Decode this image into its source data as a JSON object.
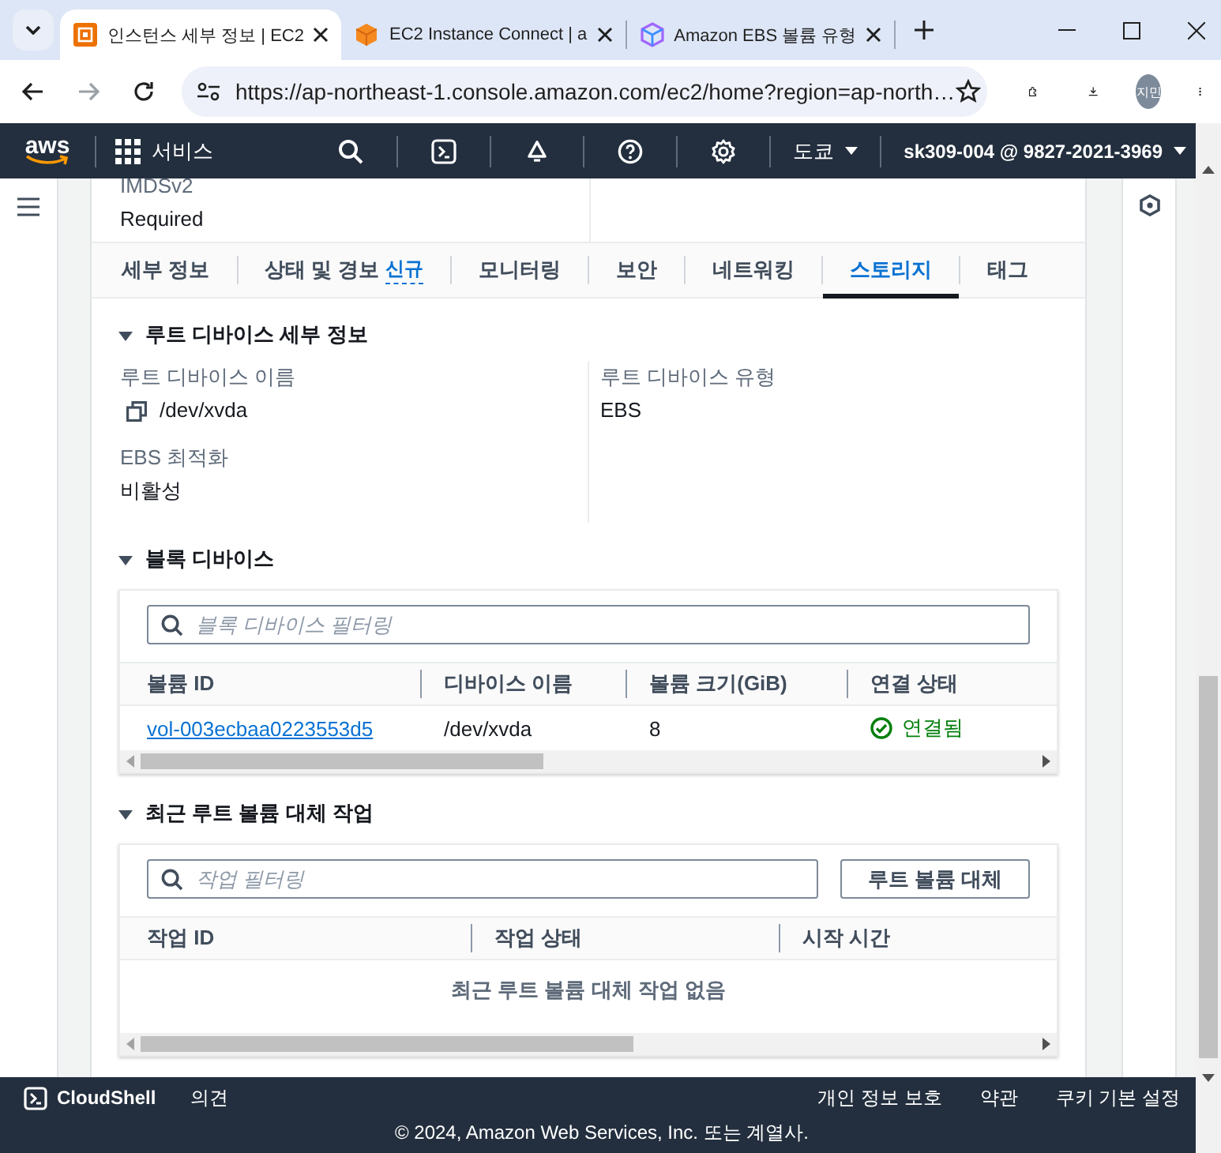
{
  "browser": {
    "tabs": [
      {
        "title": "인스턴스 세부 정보 | EC2",
        "selected": true
      },
      {
        "title": "EC2 Instance Connect | a",
        "selected": false
      },
      {
        "title": "Amazon EBS 볼륨 유형",
        "selected": false
      }
    ],
    "url": "https://ap-northeast-1.console.amazon.com/ec2/home?region=ap-north…",
    "profile": "지민"
  },
  "console_nav": {
    "logo": "aws",
    "services": "서비스",
    "region": "도쿄",
    "account": "sk309-004 @ 9827-2021-3969"
  },
  "summary": {
    "label": "IMDSv2",
    "value": "Required"
  },
  "tabs": [
    {
      "label": "세부 정보",
      "selected": false
    },
    {
      "label": "상태 및 경보",
      "badge": "신규",
      "selected": false
    },
    {
      "label": "모니터링",
      "selected": false
    },
    {
      "label": "보안",
      "selected": false
    },
    {
      "label": "네트워킹",
      "selected": false
    },
    {
      "label": "스토리지",
      "selected": true
    },
    {
      "label": "태그",
      "selected": false
    }
  ],
  "root_device": {
    "title": "루트 디바이스 세부 정보",
    "expanded": true,
    "fields": [
      {
        "label": "루트 디바이스 이름",
        "value": "/dev/xvda",
        "copyable": true
      },
      {
        "label": "루트 디바이스 유형",
        "value": "EBS",
        "copyable": false
      },
      {
        "label": "EBS 최적화",
        "value": "비활성",
        "copyable": false
      }
    ]
  },
  "block_devices": {
    "title": "블록 디바이스",
    "expanded": true,
    "filter": {
      "placeholder": "블록 디바이스 필터링"
    },
    "columns": [
      "볼륨 ID",
      "디바이스 이름",
      "볼륨 크기(GiB)",
      "연결 상태"
    ],
    "rows": [
      {
        "cells": [
          {
            "kind": "link",
            "text": "vol-003ecbaa0223553d5"
          },
          {
            "kind": "text",
            "text": "/dev/xvda"
          },
          {
            "kind": "text",
            "text": "8"
          },
          {
            "kind": "status",
            "text": "연결됨"
          }
        ]
      }
    ]
  },
  "root_volume_replacement": {
    "title": "최근 루트 볼륨 대체 작업",
    "expanded": true,
    "filter": {
      "placeholder": "작업 필터링"
    },
    "button": "루트 볼륨 대체",
    "columns": [
      "작업 ID",
      "작업 상태",
      "시작 시간"
    ],
    "empty_message": "최근 루트 볼륨 대체 작업 없음"
  },
  "footer": {
    "left": [
      "CloudShell",
      "의견"
    ],
    "right": [
      "개인 정보 보호",
      "약관",
      "쿠키 기본 설정"
    ],
    "copyright": "© 2024, Amazon Web Services, Inc. 또는 계열사."
  }
}
